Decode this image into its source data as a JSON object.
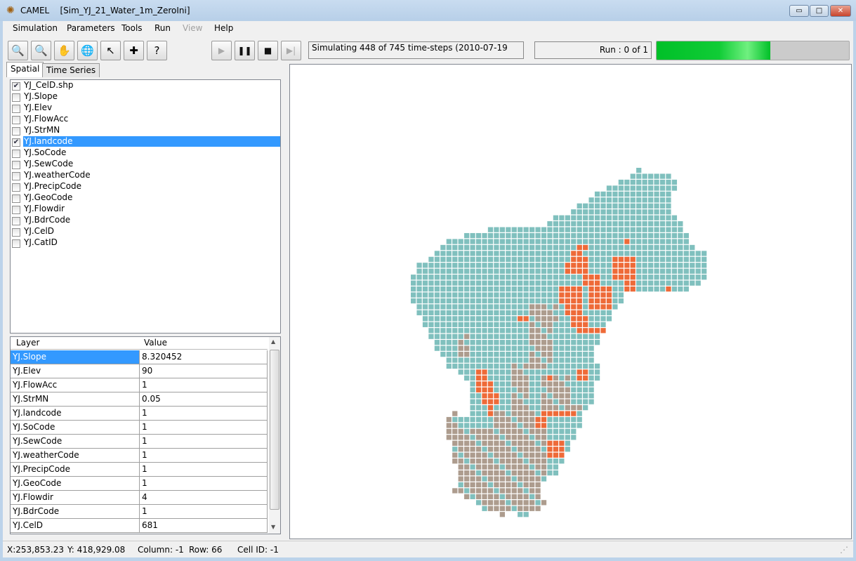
{
  "window": {
    "app": "CAMEL",
    "project": "[Sim_YJ_21_Water_1m_ZeroIni]",
    "min": "▭",
    "max": "□",
    "close": "✕"
  },
  "menu": [
    "Simulation",
    "Parameters",
    "Tools",
    "Run",
    "View",
    "Help"
  ],
  "menu_disabled": [
    "View"
  ],
  "toolbar": {
    "tools": [
      {
        "icon": "zoom-in-icon",
        "glyph": "🔍"
      },
      {
        "icon": "zoom-out-icon",
        "glyph": "🔍"
      },
      {
        "icon": "pan-hand-icon",
        "glyph": "✋"
      },
      {
        "icon": "globe-icon",
        "glyph": "🌐"
      },
      {
        "icon": "arrow-select-icon",
        "glyph": "↖"
      },
      {
        "icon": "crosshair-icon",
        "glyph": "✚"
      },
      {
        "icon": "identify-icon",
        "glyph": "?"
      }
    ],
    "playback": [
      {
        "icon": "play-icon",
        "glyph": "▶",
        "enabled": false
      },
      {
        "icon": "pause-icon",
        "glyph": "❚❚",
        "enabled": true
      },
      {
        "icon": "stop-icon",
        "glyph": "■",
        "enabled": true
      },
      {
        "icon": "step-icon",
        "glyph": "▶|",
        "enabled": false
      }
    ]
  },
  "sim_status": "Simulating 448 of 745 time-steps (2010-07-19",
  "run_status": "Run : 0 of 1",
  "progress_percent": 59,
  "tabs": [
    {
      "label": "Spatial",
      "active": true
    },
    {
      "label": "Time Series",
      "active": false
    }
  ],
  "layers": [
    {
      "name": "YJ_CelD.shp",
      "checked": true
    },
    {
      "name": "YJ.Slope",
      "checked": false
    },
    {
      "name": "YJ.Elev",
      "checked": false
    },
    {
      "name": "YJ.FlowAcc",
      "checked": false
    },
    {
      "name": "YJ.StrMN",
      "checked": false
    },
    {
      "name": "YJ.landcode",
      "checked": true,
      "selected": true
    },
    {
      "name": "YJ.SoCode",
      "checked": false
    },
    {
      "name": "YJ.SewCode",
      "checked": false
    },
    {
      "name": "YJ.weatherCode",
      "checked": false
    },
    {
      "name": "YJ.PrecipCode",
      "checked": false
    },
    {
      "name": "YJ.GeoCode",
      "checked": false
    },
    {
      "name": "YJ.Flowdir",
      "checked": false
    },
    {
      "name": "YJ.BdrCode",
      "checked": false
    },
    {
      "name": "YJ.CelD",
      "checked": false
    },
    {
      "name": "YJ.CatID",
      "checked": false
    }
  ],
  "grid": {
    "headers": [
      "Layer",
      "Value"
    ],
    "rows": [
      [
        "YJ.Slope",
        "8.320452"
      ],
      [
        "YJ.Elev",
        "90"
      ],
      [
        "YJ.FlowAcc",
        "1"
      ],
      [
        "YJ.StrMN",
        "0.05"
      ],
      [
        "YJ.landcode",
        "1"
      ],
      [
        "YJ.SoCode",
        "1"
      ],
      [
        "YJ.SewCode",
        "1"
      ],
      [
        "YJ.weatherCode",
        "1"
      ],
      [
        "YJ.PrecipCode",
        "1"
      ],
      [
        "YJ.GeoCode",
        "1"
      ],
      [
        "YJ.Flowdir",
        "4"
      ],
      [
        "YJ.BdrCode",
        "1"
      ],
      [
        "YJ.CelD",
        "681"
      ]
    ]
  },
  "statusbar": {
    "x": "X:253,853.23",
    "y": "Y: 418,929.08",
    "column": "Column: -1",
    "row": "Row: 66",
    "cell": "Cell ID: -1"
  },
  "map": {
    "colors": {
      "default": "#80c0be",
      "orange": "#ee6a38",
      "brown": "#ad9c8e"
    },
    "rows": [
      [
        [
          38,
          38
        ]
      ],
      [
        [
          37,
          43
        ]
      ],
      [
        [
          35,
          44
        ]
      ],
      [
        [
          33,
          44
        ]
      ],
      [
        [
          31,
          43
        ]
      ],
      [
        [
          30,
          43
        ]
      ],
      [
        [
          28,
          43
        ]
      ],
      [
        [
          27,
          43
        ]
      ],
      [
        [
          24,
          44
        ]
      ],
      [
        [
          23,
          45
        ]
      ],
      [
        [
          13,
          45
        ]
      ],
      [
        [
          9,
          46
        ]
      ],
      [
        [
          6,
          46
        ]
      ],
      [
        [
          5,
          47
        ]
      ],
      [
        [
          4,
          49
        ]
      ],
      [
        [
          3,
          49
        ]
      ],
      [
        [
          1,
          49
        ]
      ],
      [
        [
          1,
          49
        ]
      ],
      [
        [
          0,
          49
        ]
      ],
      [
        [
          0,
          48
        ]
      ],
      [
        [
          0,
          46
        ]
      ],
      [
        [
          0,
          35
        ]
      ],
      [
        [
          0,
          35
        ]
      ],
      [
        [
          1,
          34
        ]
      ],
      [
        [
          1,
          33
        ]
      ],
      [
        [
          2,
          33
        ]
      ],
      [
        [
          2,
          32
        ]
      ],
      [
        [
          3,
          32
        ]
      ],
      [
        [
          3,
          31
        ]
      ],
      [
        [
          4,
          31
        ]
      ],
      [
        [
          4,
          30
        ]
      ],
      [
        [
          5,
          30
        ]
      ],
      [
        [
          6,
          30
        ]
      ],
      [
        [
          6,
          31
        ]
      ],
      [
        [
          8,
          31
        ]
      ],
      [
        [
          9,
          31
        ]
      ],
      [
        [
          10,
          30
        ]
      ],
      [
        [
          10,
          30
        ]
      ],
      [
        [
          10,
          30
        ]
      ],
      [
        [
          10,
          30
        ]
      ],
      [
        [
          10,
          29
        ]
      ],
      [
        [
          7,
          7
        ],
        [
          10,
          28
        ]
      ],
      [
        [
          6,
          28
        ]
      ],
      [
        [
          6,
          28
        ]
      ],
      [
        [
          6,
          27
        ]
      ],
      [
        [
          6,
          27
        ]
      ],
      [
        [
          7,
          26
        ]
      ],
      [
        [
          7,
          26
        ]
      ],
      [
        [
          7,
          25
        ]
      ],
      [
        [
          7,
          25
        ]
      ],
      [
        [
          8,
          24
        ]
      ],
      [
        [
          8,
          24
        ]
      ],
      [
        [
          8,
          22
        ]
      ],
      [
        [
          8,
          21
        ]
      ],
      [
        [
          7,
          21
        ]
      ],
      [
        [
          9,
          21
        ]
      ],
      [
        [
          11,
          22
        ]
      ],
      [
        [
          12,
          21
        ]
      ],
      [
        [
          15,
          15
        ],
        [
          18,
          19
        ]
      ]
    ],
    "orange": [
      [
        28,
        13,
        29,
        13
      ],
      [
        27,
        14,
        28,
        15
      ],
      [
        26,
        16,
        28,
        17
      ],
      [
        29,
        15,
        29,
        17
      ],
      [
        29,
        18,
        31,
        19
      ],
      [
        25,
        20,
        28,
        22
      ],
      [
        30,
        20,
        33,
        23
      ],
      [
        26,
        23,
        28,
        24
      ],
      [
        27,
        25,
        29,
        26
      ],
      [
        28,
        27,
        32,
        27
      ],
      [
        32,
        28,
        32,
        28
      ],
      [
        34,
        15,
        37,
        18
      ],
      [
        36,
        19,
        37,
        21
      ],
      [
        36,
        12,
        36,
        12
      ],
      [
        43,
        20,
        43,
        20
      ],
      [
        18,
        25,
        19,
        25
      ],
      [
        11,
        34,
        12,
        35
      ],
      [
        11,
        36,
        13,
        37
      ],
      [
        12,
        38,
        14,
        39
      ],
      [
        13,
        40,
        13,
        41
      ],
      [
        22,
        41,
        27,
        41
      ],
      [
        21,
        42,
        22,
        43
      ],
      [
        23,
        46,
        25,
        48
      ],
      [
        28,
        34,
        29,
        35
      ],
      [
        23,
        35,
        23,
        35
      ]
    ],
    "brown": [
      [
        8,
        28,
        9,
        31
      ],
      [
        20,
        23,
        24,
        25
      ],
      [
        20,
        26,
        23,
        33
      ],
      [
        17,
        33,
        19,
        40
      ],
      [
        22,
        35,
        26,
        40
      ],
      [
        25,
        40,
        28,
        40
      ],
      [
        6,
        41,
        7,
        45
      ],
      [
        14,
        41,
        20,
        44
      ],
      [
        7,
        44,
        22,
        57
      ],
      [
        14,
        57,
        16,
        58
      ]
    ]
  }
}
